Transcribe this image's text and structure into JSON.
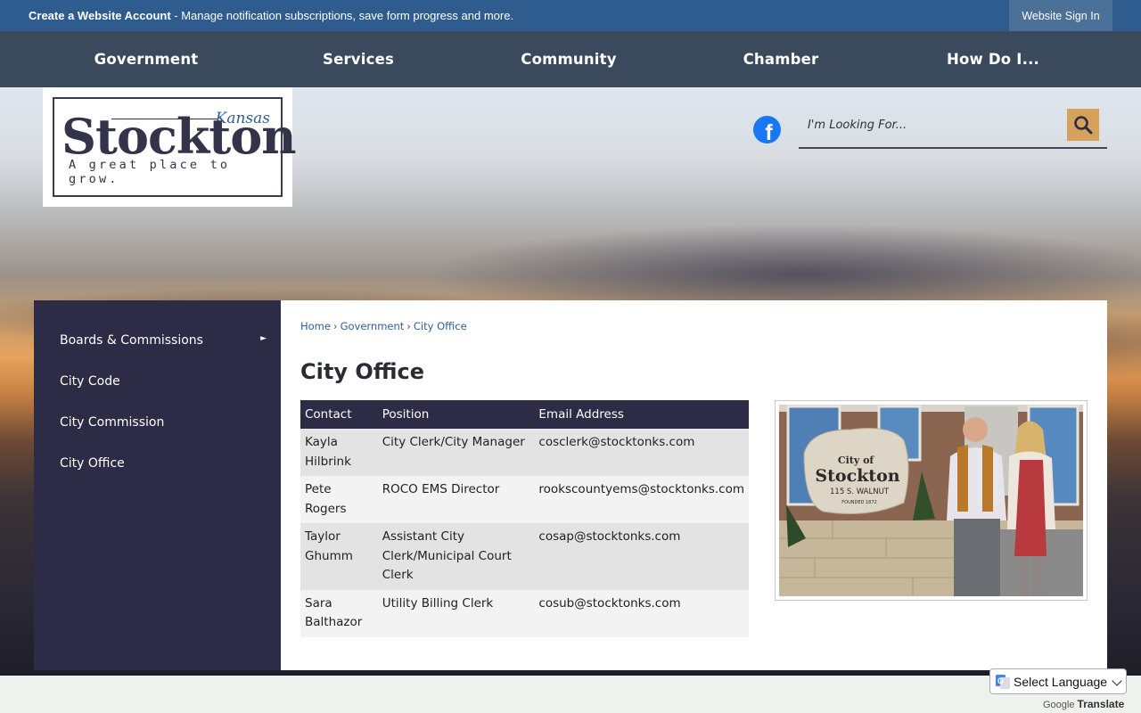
{
  "notify": {
    "bold": "Create a Website Account",
    "text": " - Manage notification subscriptions, save form progress and more.",
    "signin": "Website Sign In"
  },
  "nav": [
    "Government",
    "Services",
    "Community",
    "Chamber",
    "How Do I..."
  ],
  "logo": {
    "word": "Stockton",
    "state": "Kansas",
    "tagline": "A great place to grow."
  },
  "search": {
    "placeholder": "I'm Looking For..."
  },
  "sidebar": {
    "items": [
      {
        "label": "Boards & Commissions",
        "has_submenu": true
      },
      {
        "label": "City Code"
      },
      {
        "label": "City Commission"
      },
      {
        "label": "City Office"
      }
    ]
  },
  "breadcrumb": [
    "Home",
    "Government",
    "City Office"
  ],
  "page": {
    "title": "City Office"
  },
  "table": {
    "headers": [
      "Contact",
      "Position",
      "Email Address"
    ],
    "rows": [
      {
        "contact": "Kayla Hilbrink",
        "position": "City Clerk/City Manager",
        "email": "cosclerk@stocktonks.com"
      },
      {
        "contact": "Pete Rogers",
        "position": "ROCO EMS Director",
        "email": "rookscountyems@stocktonks.com"
      },
      {
        "contact": "Taylor Ghumm",
        "position": "Assistant City Clerk/Municipal Court Clerk",
        "email": "cosap@stocktonks.com"
      },
      {
        "contact": "Sara Balthazor",
        "position": "Utility Billing Clerk",
        "email": "cosub@stocktonks.com"
      }
    ]
  },
  "photo": {
    "sign_line1": "City of",
    "sign_line2": "Stockton",
    "sign_line3": "115 S. WALNUT",
    "sign_line4": "FOUNDED 1872"
  },
  "translate": {
    "select_label": "Select Language",
    "credit_google": "Google",
    "credit_translate": "Translate"
  },
  "colors": {
    "notify_bar": "#2e5c8e",
    "nav": "#3a4a5c",
    "sidebar": "#2c2c47",
    "search_button": "#d6a15a",
    "link": "#2f5e93"
  }
}
